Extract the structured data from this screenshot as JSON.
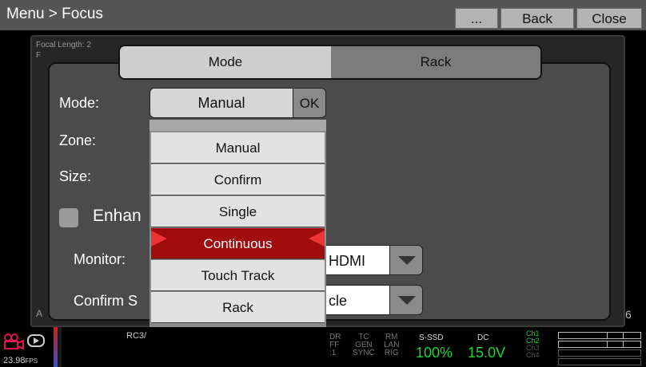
{
  "titlebar": {
    "title": "Menu > Focus",
    "buttons": [
      "...",
      "Back",
      "Close"
    ]
  },
  "background": {
    "focal_length_label": "Focal Length: 2",
    "left_letter_f": "F",
    "left_letter_a": "A",
    "right_digit": "6"
  },
  "tabs": [
    "Mode",
    "Rack"
  ],
  "form": {
    "mode_label": "Mode:",
    "mode_value": "Manual",
    "ok_label": "OK",
    "zone_label": "Zone:",
    "size_label": "Size:",
    "enhance_label": "Enhan",
    "monitor_label": "Monitor:",
    "monitor_value": "HDMI",
    "confirm_label": "Confirm S",
    "confirm_value": "cle"
  },
  "dropdown": {
    "items": [
      "Manual",
      "Confirm",
      "Single",
      "Continuous",
      "Touch Track",
      "Rack"
    ],
    "selected": "Continuous"
  },
  "statusbar": {
    "fps": "23.98",
    "fps_unit": "FPS",
    "rc": "RC3/",
    "dr_col": [
      "DR",
      "FF",
      ":1"
    ],
    "tc_col": [
      "TC",
      "GEN",
      "SYNC"
    ],
    "rm_col": [
      "RM",
      "LAN",
      "RIG"
    ],
    "media_label": "S-SSD",
    "media_value": "100%",
    "power_label": "DC",
    "power_value": "15.0V",
    "channels": [
      "Ch1",
      "Ch2",
      "Ch3",
      "Ch4"
    ]
  },
  "colors": {
    "accent_green": "#19d43a",
    "selected_red": "#a10d0d",
    "marker_red": "#ee3333"
  },
  "icons": [
    "camera-icon",
    "play-icon"
  ]
}
